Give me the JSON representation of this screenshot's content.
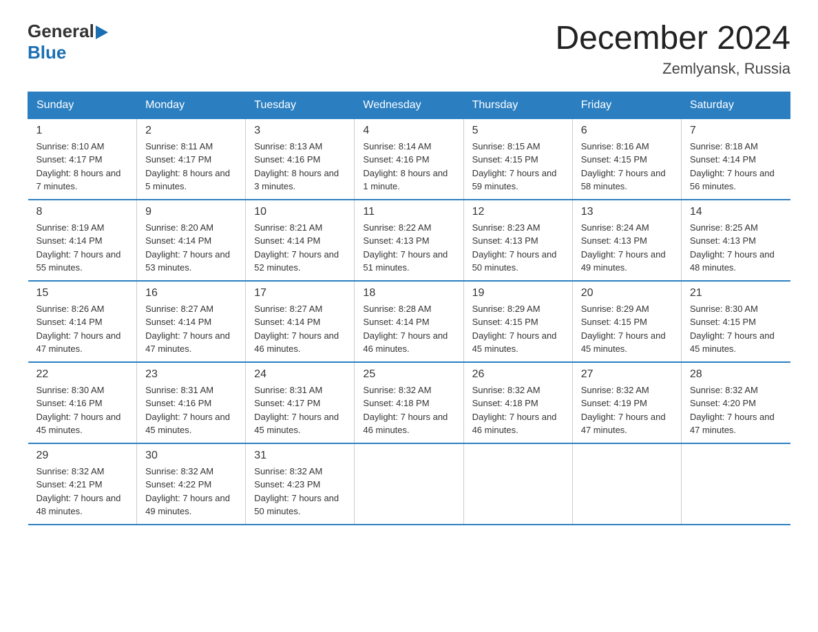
{
  "logo": {
    "text_general": "General",
    "text_blue": "Blue",
    "arrow": "▶"
  },
  "title": "December 2024",
  "location": "Zemlyansk, Russia",
  "weekdays": [
    "Sunday",
    "Monday",
    "Tuesday",
    "Wednesday",
    "Thursday",
    "Friday",
    "Saturday"
  ],
  "weeks": [
    [
      {
        "day": "1",
        "sunrise": "8:10 AM",
        "sunset": "4:17 PM",
        "daylight": "8 hours and 7 minutes."
      },
      {
        "day": "2",
        "sunrise": "8:11 AM",
        "sunset": "4:17 PM",
        "daylight": "8 hours and 5 minutes."
      },
      {
        "day": "3",
        "sunrise": "8:13 AM",
        "sunset": "4:16 PM",
        "daylight": "8 hours and 3 minutes."
      },
      {
        "day": "4",
        "sunrise": "8:14 AM",
        "sunset": "4:16 PM",
        "daylight": "8 hours and 1 minute."
      },
      {
        "day": "5",
        "sunrise": "8:15 AM",
        "sunset": "4:15 PM",
        "daylight": "7 hours and 59 minutes."
      },
      {
        "day": "6",
        "sunrise": "8:16 AM",
        "sunset": "4:15 PM",
        "daylight": "7 hours and 58 minutes."
      },
      {
        "day": "7",
        "sunrise": "8:18 AM",
        "sunset": "4:14 PM",
        "daylight": "7 hours and 56 minutes."
      }
    ],
    [
      {
        "day": "8",
        "sunrise": "8:19 AM",
        "sunset": "4:14 PM",
        "daylight": "7 hours and 55 minutes."
      },
      {
        "day": "9",
        "sunrise": "8:20 AM",
        "sunset": "4:14 PM",
        "daylight": "7 hours and 53 minutes."
      },
      {
        "day": "10",
        "sunrise": "8:21 AM",
        "sunset": "4:14 PM",
        "daylight": "7 hours and 52 minutes."
      },
      {
        "day": "11",
        "sunrise": "8:22 AM",
        "sunset": "4:13 PM",
        "daylight": "7 hours and 51 minutes."
      },
      {
        "day": "12",
        "sunrise": "8:23 AM",
        "sunset": "4:13 PM",
        "daylight": "7 hours and 50 minutes."
      },
      {
        "day": "13",
        "sunrise": "8:24 AM",
        "sunset": "4:13 PM",
        "daylight": "7 hours and 49 minutes."
      },
      {
        "day": "14",
        "sunrise": "8:25 AM",
        "sunset": "4:13 PM",
        "daylight": "7 hours and 48 minutes."
      }
    ],
    [
      {
        "day": "15",
        "sunrise": "8:26 AM",
        "sunset": "4:14 PM",
        "daylight": "7 hours and 47 minutes."
      },
      {
        "day": "16",
        "sunrise": "8:27 AM",
        "sunset": "4:14 PM",
        "daylight": "7 hours and 47 minutes."
      },
      {
        "day": "17",
        "sunrise": "8:27 AM",
        "sunset": "4:14 PM",
        "daylight": "7 hours and 46 minutes."
      },
      {
        "day": "18",
        "sunrise": "8:28 AM",
        "sunset": "4:14 PM",
        "daylight": "7 hours and 46 minutes."
      },
      {
        "day": "19",
        "sunrise": "8:29 AM",
        "sunset": "4:15 PM",
        "daylight": "7 hours and 45 minutes."
      },
      {
        "day": "20",
        "sunrise": "8:29 AM",
        "sunset": "4:15 PM",
        "daylight": "7 hours and 45 minutes."
      },
      {
        "day": "21",
        "sunrise": "8:30 AM",
        "sunset": "4:15 PM",
        "daylight": "7 hours and 45 minutes."
      }
    ],
    [
      {
        "day": "22",
        "sunrise": "8:30 AM",
        "sunset": "4:16 PM",
        "daylight": "7 hours and 45 minutes."
      },
      {
        "day": "23",
        "sunrise": "8:31 AM",
        "sunset": "4:16 PM",
        "daylight": "7 hours and 45 minutes."
      },
      {
        "day": "24",
        "sunrise": "8:31 AM",
        "sunset": "4:17 PM",
        "daylight": "7 hours and 45 minutes."
      },
      {
        "day": "25",
        "sunrise": "8:32 AM",
        "sunset": "4:18 PM",
        "daylight": "7 hours and 46 minutes."
      },
      {
        "day": "26",
        "sunrise": "8:32 AM",
        "sunset": "4:18 PM",
        "daylight": "7 hours and 46 minutes."
      },
      {
        "day": "27",
        "sunrise": "8:32 AM",
        "sunset": "4:19 PM",
        "daylight": "7 hours and 47 minutes."
      },
      {
        "day": "28",
        "sunrise": "8:32 AM",
        "sunset": "4:20 PM",
        "daylight": "7 hours and 47 minutes."
      }
    ],
    [
      {
        "day": "29",
        "sunrise": "8:32 AM",
        "sunset": "4:21 PM",
        "daylight": "7 hours and 48 minutes."
      },
      {
        "day": "30",
        "sunrise": "8:32 AM",
        "sunset": "4:22 PM",
        "daylight": "7 hours and 49 minutes."
      },
      {
        "day": "31",
        "sunrise": "8:32 AM",
        "sunset": "4:23 PM",
        "daylight": "7 hours and 50 minutes."
      },
      null,
      null,
      null,
      null
    ]
  ]
}
